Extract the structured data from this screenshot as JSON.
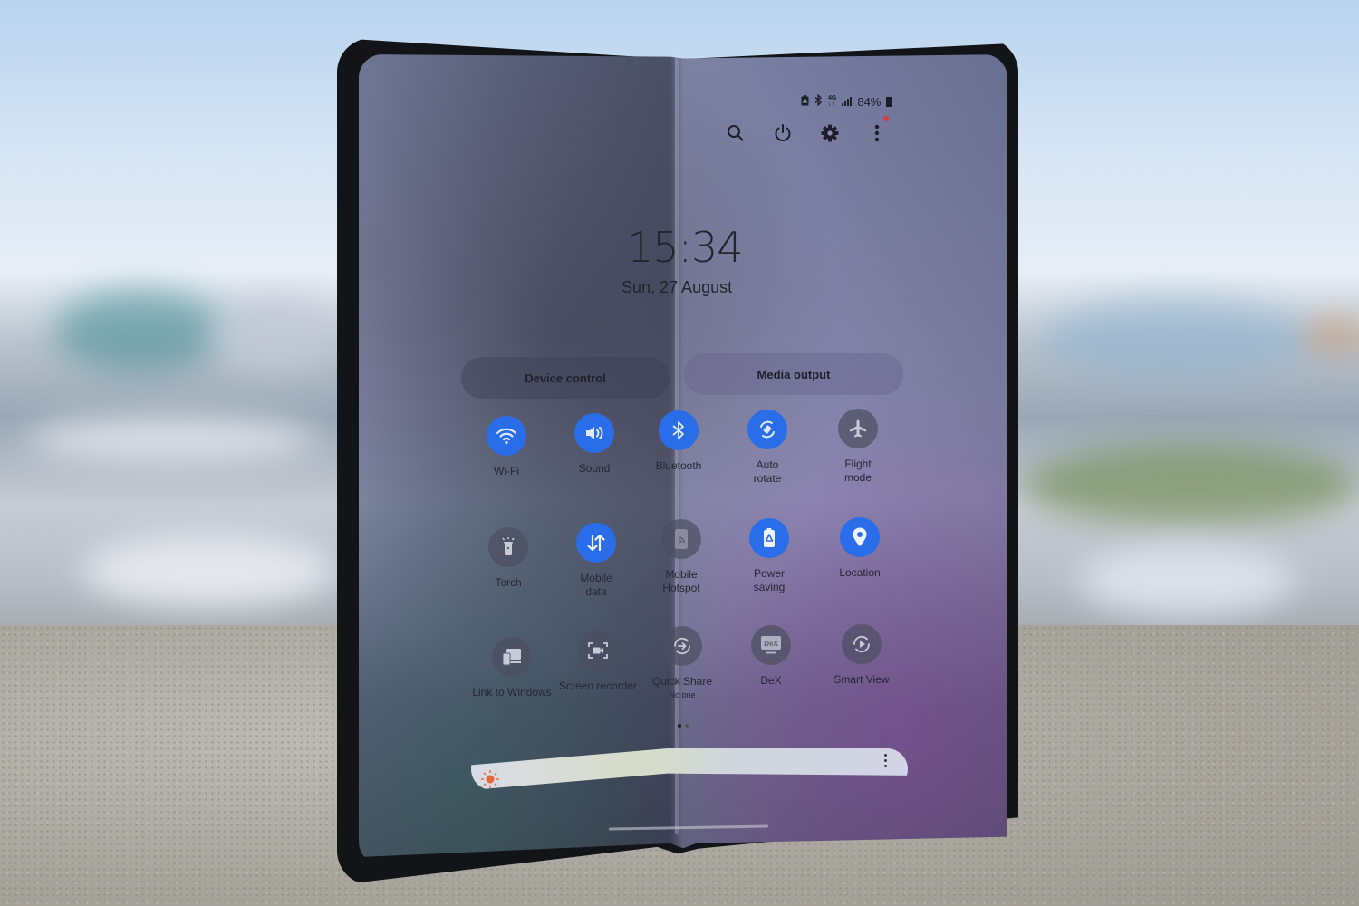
{
  "scene": {
    "description": "Photo of a foldable phone standing half-open on a stone wall, showing the quick settings panel",
    "colors": {
      "sky": "#c9dcef",
      "ground": "#aaa69e",
      "phone_frame": "#121418",
      "tile_active": "#2a6de8",
      "tile_inactive": "#4b4e5f",
      "brightness_icon": "#e4683a",
      "notification_dot": "#e2392f"
    }
  },
  "status_bar": {
    "icons": [
      "battery-saver-icon",
      "bluetooth-icon",
      "4g-icon",
      "signal-icon",
      "battery-icon"
    ],
    "network_label": "4G",
    "battery_percent": "84%"
  },
  "quick_panel_toolbar": {
    "icons": [
      "search-icon",
      "power-icon",
      "settings-gear-icon",
      "more-options-icon"
    ]
  },
  "clock": {
    "time": "15:34",
    "date": "Sun, 27 August"
  },
  "buttons": {
    "device_control": "Device control",
    "media_output": "Media output"
  },
  "tiles": [
    {
      "label": "Wi-Fi",
      "icon": "wifi-icon",
      "active": true
    },
    {
      "label": "Sound",
      "icon": "speaker-icon",
      "active": true
    },
    {
      "label": "Bluetooth",
      "icon": "bluetooth-icon",
      "active": true
    },
    {
      "label": "Auto rotate",
      "icon": "auto-rotate-icon",
      "active": true
    },
    {
      "label": "Flight mode",
      "icon": "airplane-icon",
      "active": false
    },
    {
      "label": "Torch",
      "icon": "torch-icon",
      "active": false
    },
    {
      "label": "Mobile data",
      "icon": "mobile-data-icon",
      "active": true
    },
    {
      "label": "Mobile Hotspot",
      "icon": "hotspot-icon",
      "active": false
    },
    {
      "label": "Power saving",
      "icon": "power-saving-icon",
      "active": true
    },
    {
      "label": "Location",
      "icon": "location-pin-icon",
      "active": true
    },
    {
      "label": "Link to Windows",
      "icon": "link-to-windows-icon",
      "active": false
    },
    {
      "label": "Screen recorder",
      "icon": "screen-recorder-icon",
      "active": false
    },
    {
      "label": "Quick Share",
      "sublabel": "No one",
      "icon": "quick-share-icon",
      "active": false
    },
    {
      "label": "DeX",
      "icon": "dex-icon",
      "active": false,
      "glyph_text": "DeX"
    },
    {
      "label": "Smart View",
      "icon": "smart-view-icon",
      "active": false
    }
  ],
  "pager": {
    "pages": 2,
    "current": 1
  },
  "brightness": {
    "icon": "sun-icon",
    "menu_icon": "more-options-icon"
  }
}
